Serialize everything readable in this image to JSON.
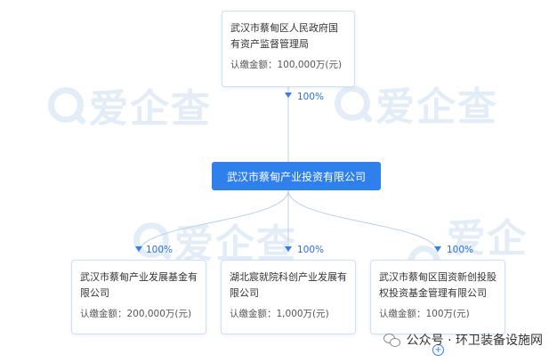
{
  "watermark": {
    "text": "爱企查"
  },
  "nodes": {
    "top": {
      "name": "武汉市蔡甸区人民政府国有资产监督管理局",
      "amount": "认缴金额：100,000万(元)"
    },
    "center": {
      "name": "武汉市蔡甸产业投资有限公司"
    },
    "child1": {
      "name": "武汉市蔡甸产业发展基金有限公司",
      "amount": "认缴金额：200,000万(元)"
    },
    "child2": {
      "name": "湖北宸就院科创产业发展有限公司",
      "amount": "认缴金额：1,000万(元)"
    },
    "child3": {
      "name": "武汉市蔡甸区国资新创投股权投资基金管理有限公司",
      "amount": "认缴金额：100万(元)"
    }
  },
  "percents": {
    "top": "100%",
    "child1": "100%",
    "child2": "100%",
    "child3": "100%"
  },
  "footer": {
    "text": "公众号 · 环卫装备设施网"
  },
  "colors": {
    "accent": "#2f80ed",
    "line": "#b9cff0",
    "border": "#cfe0f5",
    "watermark": "#e3edf8"
  }
}
